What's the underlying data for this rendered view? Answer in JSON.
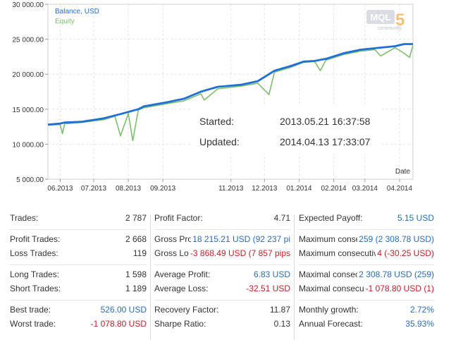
{
  "chart_data": {
    "type": "line",
    "legend": [
      "Balance, USD",
      "Equity"
    ],
    "legend_placement": "top-left",
    "colors": {
      "balance": "#1e6fd6",
      "equity": "#7dbf6a"
    },
    "ylim": [
      5000,
      30000
    ],
    "y_ticks": [
      "30 000.00",
      "25 000.00",
      "20 000.00",
      "15 000.00",
      "10 000.00",
      "5 000.00"
    ],
    "x_ticks": [
      "06.2013",
      "07.2013",
      "08.2013",
      "09.2013",
      "11.2013",
      "12.2013",
      "01.2014",
      "02.2014",
      "03.2014",
      "04.2014"
    ],
    "xlabel": "Date",
    "ylabel": "",
    "grid": true,
    "series": [
      {
        "name": "Balance, USD",
        "x": [
          "2013-05-21",
          "2013-06-01",
          "2013-06-05",
          "2013-06-20",
          "2013-07-10",
          "2013-07-25",
          "2013-08-10",
          "2013-08-15",
          "2013-09-05",
          "2013-09-20",
          "2013-10-05",
          "2013-10-20",
          "2013-11-10",
          "2013-11-25",
          "2013-12-10",
          "2013-12-25",
          "2014-01-05",
          "2014-01-15",
          "2014-01-25",
          "2014-02-10",
          "2014-02-25",
          "2014-03-15",
          "2014-03-28",
          "2014-04-05",
          "2014-04-13"
        ],
        "y": [
          12800,
          12950,
          13100,
          13200,
          13700,
          14300,
          15000,
          15400,
          16000,
          16500,
          17500,
          18200,
          18500,
          19000,
          20500,
          21200,
          21800,
          21900,
          22200,
          23000,
          23500,
          23800,
          24000,
          24300,
          24300
        ]
      },
      {
        "name": "Equity",
        "x": [
          "2013-05-21",
          "2013-06-01",
          "2013-06-03",
          "2013-06-05",
          "2013-06-20",
          "2013-07-10",
          "2013-07-20",
          "2013-07-25",
          "2013-08-01",
          "2013-08-05",
          "2013-08-10",
          "2013-08-15",
          "2013-09-05",
          "2013-09-20",
          "2013-10-05",
          "2013-10-08",
          "2013-10-20",
          "2013-11-10",
          "2013-11-25",
          "2013-12-05",
          "2013-12-10",
          "2013-12-25",
          "2014-01-05",
          "2014-01-15",
          "2014-01-20",
          "2014-01-25",
          "2014-02-10",
          "2014-02-25",
          "2014-03-10",
          "2014-03-15",
          "2014-03-28",
          "2014-04-05",
          "2014-04-10",
          "2014-04-13"
        ],
        "y": [
          12700,
          12800,
          11500,
          12900,
          13100,
          13500,
          14000,
          11200,
          14400,
          10500,
          14900,
          15200,
          15800,
          16200,
          17200,
          16300,
          17900,
          18300,
          18700,
          17100,
          20300,
          21000,
          21700,
          21800,
          20500,
          22000,
          22800,
          23300,
          23500,
          22600,
          23800,
          23000,
          22400,
          24100
        ]
      }
    ]
  },
  "watermark": {
    "brand": "MQL",
    "number": "5",
    "sub": "community"
  },
  "info": {
    "started_label": "Started:",
    "started_value": "2013.05.21 16:37:58",
    "updated_label": "Updated:",
    "updated_value": "2014.04.13 17:33:07"
  },
  "stats": {
    "col1": [
      {
        "label": "Trades:",
        "value": "2 787",
        "color": "dark"
      },
      {
        "label": "Profit Trades:",
        "value": "2 668",
        "color": "dark"
      },
      {
        "label": "Loss Trades:",
        "value": "119",
        "color": "dark"
      },
      {
        "label": "Long Trades:",
        "value": "1 598",
        "color": "dark"
      },
      {
        "label": "Short Trades:",
        "value": "1 189",
        "color": "dark"
      },
      {
        "label": "Best trade:",
        "value": "526.00 USD",
        "color": "blue"
      },
      {
        "label": "Worst trade:",
        "value": "-1 078.80 USD",
        "color": "red"
      }
    ],
    "col2": [
      {
        "label": "Profit Factor:",
        "value": "4.71",
        "color": "dark"
      },
      {
        "label": "Gross Profi",
        "value": "18 215.21 USD (92 237 pi",
        "color": "blue"
      },
      {
        "label": "Gross Loss",
        "value": "-3 868.49 USD (7 857 pips",
        "color": "red"
      },
      {
        "label": "Average Profit:",
        "value": "6.83 USD",
        "color": "blue"
      },
      {
        "label": "Average Loss:",
        "value": "-32.51 USD",
        "color": "red"
      },
      {
        "label": "Recovery Factor:",
        "value": "11.87",
        "color": "dark"
      },
      {
        "label": "Sharpe Ratio:",
        "value": "0.13",
        "color": "dark"
      }
    ],
    "col3": [
      {
        "label": "Expected Payoff:",
        "value": "5.15 USD",
        "color": "blue"
      },
      {
        "label": "Maximum consec",
        "value": "259 (2 308.78 USD)",
        "color": "blue"
      },
      {
        "label": "Maximum consecutive",
        "value": "4 (-30.25 USD)",
        "color": "red"
      },
      {
        "label": "Maximal consecu",
        "value": "2 308.78 USD (259)",
        "color": "blue"
      },
      {
        "label": "Maximal consecuti",
        "value": "-1 078.80 USD (1)",
        "color": "red"
      },
      {
        "label": "Monthly growth:",
        "value": "2.72%",
        "color": "blue"
      },
      {
        "label": "Annual Forecast:",
        "value": "35.93%",
        "color": "blue"
      }
    ]
  }
}
